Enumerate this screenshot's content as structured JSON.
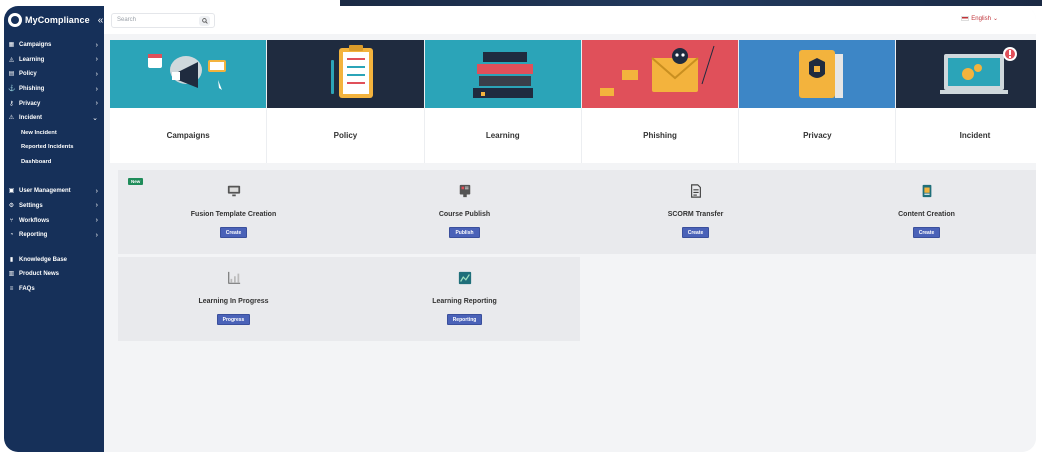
{
  "app": {
    "brand_name": "MyCompliance"
  },
  "search": {
    "placeholder": "Search"
  },
  "language": {
    "label": "English"
  },
  "sidebar": {
    "items": [
      {
        "label": "Campaigns",
        "icon": "campaign-icon",
        "chevron": true
      },
      {
        "label": "Learning",
        "icon": "graduation-cap-icon",
        "chevron": true
      },
      {
        "label": "Policy",
        "icon": "document-icon",
        "chevron": true
      },
      {
        "label": "Phishing",
        "icon": "hook-icon",
        "chevron": true
      },
      {
        "label": "Privacy",
        "icon": "key-icon",
        "chevron": true
      },
      {
        "label": "Incident",
        "icon": "alert-icon",
        "chevron": true,
        "expanded": true
      }
    ],
    "incident_sub": [
      "New Incident",
      "Reported Incidents",
      "Dashboard"
    ],
    "items2": [
      {
        "label": "User Management",
        "icon": "users-icon",
        "chevron": true
      },
      {
        "label": "Settings",
        "icon": "gear-icon",
        "chevron": true
      },
      {
        "label": "Workflows",
        "icon": "workflow-icon",
        "chevron": true
      },
      {
        "label": "Reporting",
        "icon": "chart-icon",
        "chevron": true
      }
    ],
    "items3": [
      {
        "label": "Knowledge Base",
        "icon": "book-icon"
      },
      {
        "label": "Product News",
        "icon": "news-icon"
      },
      {
        "label": "FAQs",
        "icon": "faq-icon"
      }
    ]
  },
  "tiles": [
    {
      "label": "Campaigns",
      "color": "#2ba4b8"
    },
    {
      "label": "Policy",
      "color": "#1f2b3f"
    },
    {
      "label": "Learning",
      "color": "#2ba4b8"
    },
    {
      "label": "Phishing",
      "color": "#e0505a"
    },
    {
      "label": "Privacy",
      "color": "#3d86c6"
    },
    {
      "label": "Incident",
      "color": "#1f2b3f"
    }
  ],
  "cards": [
    {
      "title": "Fusion Template Creation",
      "button": "Create",
      "badge": "New",
      "icon": "monitor-icon"
    },
    {
      "title": "Course Publish",
      "button": "Publish",
      "icon": "presentation-icon"
    },
    {
      "title": "SCORM Transfer",
      "button": "Create",
      "icon": "file-transfer-icon"
    },
    {
      "title": "Content Creation",
      "button": "Create",
      "icon": "content-icon"
    },
    {
      "title": "Learning In Progress",
      "button": "Progress",
      "icon": "progress-chart-icon"
    },
    {
      "title": "Learning Reporting",
      "button": "Reporting",
      "icon": "report-icon"
    }
  ]
}
